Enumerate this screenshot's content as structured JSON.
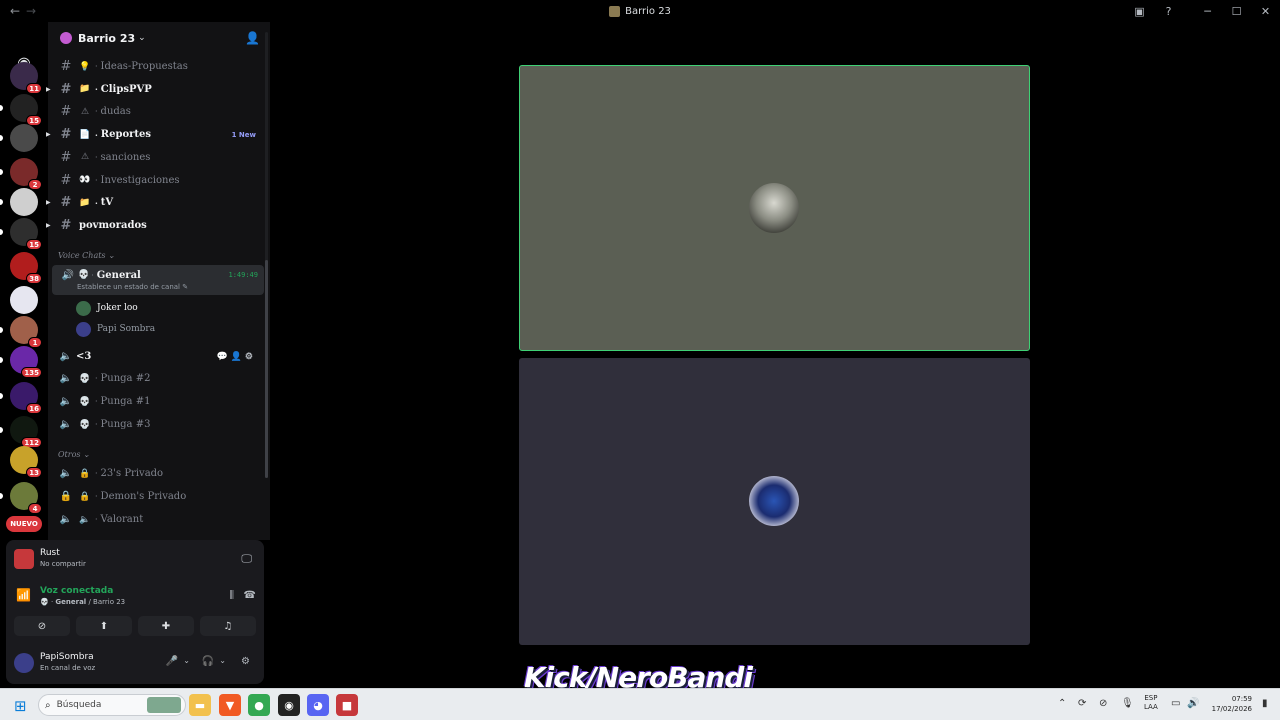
{
  "window": {
    "title": "Barrio 23",
    "back": "←",
    "forward": "→",
    "controls": [
      "─",
      "☐",
      "✕"
    ],
    "inbox_icon": "inbox-icon",
    "help": "?"
  },
  "servers": {
    "home_icon": "discord-logo-icon",
    "items": [
      {
        "badge": "11",
        "color": "#3a2a4a"
      },
      {
        "badge": "15",
        "color": "#222222"
      },
      {
        "badge": "",
        "color": "#4a4a4a"
      },
      {
        "badge": "2",
        "color": "#7a2a2a"
      },
      {
        "badge": "",
        "color": "#cfcfcf"
      },
      {
        "badge": "15",
        "color": "#2e2e2e"
      },
      {
        "badge": "38",
        "color": "#b11d1d"
      },
      {
        "badge": "",
        "color": "#e6e6f0"
      },
      {
        "badge": "1",
        "color": "#a0604a"
      },
      {
        "badge": "135",
        "color": "#6a28a8"
      },
      {
        "badge": "16",
        "color": "#3a1a6a"
      },
      {
        "badge": "112",
        "color": "#101810"
      },
      {
        "badge": "13",
        "color": "#c8a22a"
      },
      {
        "badge": "4",
        "color": "#6c7a3a"
      }
    ],
    "new_label": "NUEVO"
  },
  "sidebar": {
    "server_name": "Barrio 23",
    "channels": [
      {
        "emoji": "💡",
        "name": "Ideas-Propuestas",
        "bright": false
      },
      {
        "emoji": "📁",
        "name": "ClipsPVP",
        "bright": true
      },
      {
        "emoji": "⚠",
        "name": "dudas",
        "bright": false
      },
      {
        "emoji": "📄",
        "name": "Reportes",
        "bright": true,
        "badge": "1 New"
      },
      {
        "emoji": "⚠",
        "name": "sanciones",
        "bright": false
      },
      {
        "emoji": "👀",
        "name": "Investigaciones",
        "bright": false
      },
      {
        "emoji": "📁",
        "name": "tV",
        "bright": true
      },
      {
        "emoji": "",
        "name": "povmorados",
        "bright": true
      }
    ],
    "voice_category": "Voice Chats",
    "general": {
      "name": "General",
      "timer": "1:49:49",
      "status": "Establece un estado de canal"
    },
    "voice_users": [
      {
        "name": "Joker loo",
        "color": "#3b6b4a"
      },
      {
        "name": "Papi Sombra",
        "color": "#3b3f8a"
      }
    ],
    "voice_channels": [
      {
        "name": "<3"
      },
      {
        "name": "Punga #2"
      },
      {
        "name": "Punga #1"
      },
      {
        "name": "Punga #3"
      }
    ],
    "other_category": "Otros",
    "other_channels": [
      {
        "name": "23's Privado"
      },
      {
        "name": "Demon's Privado"
      },
      {
        "name": "Valorant"
      }
    ]
  },
  "panel": {
    "game": {
      "title": "Rust",
      "subtitle": "No compartir"
    },
    "voice": {
      "status": "Voz conectada",
      "channel": "General",
      "server": "Barrio 23"
    },
    "user": {
      "name": "PapiSombra",
      "status": "En canal de voz"
    }
  },
  "overlay": {
    "watermark": "Kick/NeroBandi"
  },
  "taskbar": {
    "search_placeholder": "Búsqueda",
    "lang_line1": "ESP",
    "lang_line2": "LAA",
    "time": "07:59",
    "date": "17/02/2026"
  }
}
